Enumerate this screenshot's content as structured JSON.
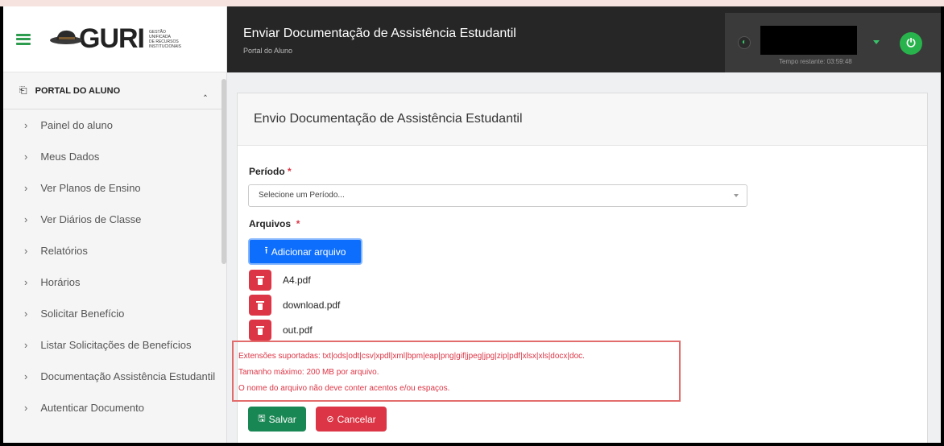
{
  "brand": {
    "logo_text": "GURI",
    "logo_sub": [
      "GESTÃO",
      "UNIFICADA",
      "DE RECURSOS",
      "INSTITUCIONAIS"
    ]
  },
  "sidebar": {
    "section_title": "PORTAL DO ALUNO",
    "items": [
      {
        "label": "Painel do aluno"
      },
      {
        "label": "Meus Dados"
      },
      {
        "label": "Ver Planos de Ensino"
      },
      {
        "label": "Ver Diários de Classe"
      },
      {
        "label": "Relatórios"
      },
      {
        "label": "Horários"
      },
      {
        "label": "Solicitar Benefício"
      },
      {
        "label": "Listar Solicitações de Benefícios"
      },
      {
        "label": "Documentação Assistência Estudantil"
      },
      {
        "label": "Autenticar Documento"
      }
    ]
  },
  "header": {
    "title": "Enviar Documentação de Assistência Estudantil",
    "subtitle": "Portal do Aluno",
    "time_left": "Tempo restante: 03:59:48"
  },
  "card": {
    "title": "Envio Documentação de Assistência Estudantil",
    "periodo_label": "Período",
    "periodo_placeholder": "Selecione um Período...",
    "arquivos_label": "Arquivos",
    "required_mark": "*",
    "add_button": "Adicionar arquivo",
    "files": [
      "A4.pdf",
      "download.pdf",
      "out.pdf"
    ],
    "warnings": [
      "Extensões suportadas: txt|ods|odt|csv|xpdl|xml|bpm|eap|png|gif|jpeg|jpg|zip|pdf|xlsx|xls|docx|doc.",
      "Tamanho máximo: 200 MB por arquivo.",
      "O nome do arquivo não deve conter acentos e/ou espaços."
    ],
    "save_button": "Salvar",
    "cancel_button": "Cancelar"
  },
  "colors": {
    "accent": "#2e9c4e",
    "primary": "#0d6efd",
    "danger": "#dc3545",
    "success": "#198754",
    "header_bg": "#262626"
  }
}
